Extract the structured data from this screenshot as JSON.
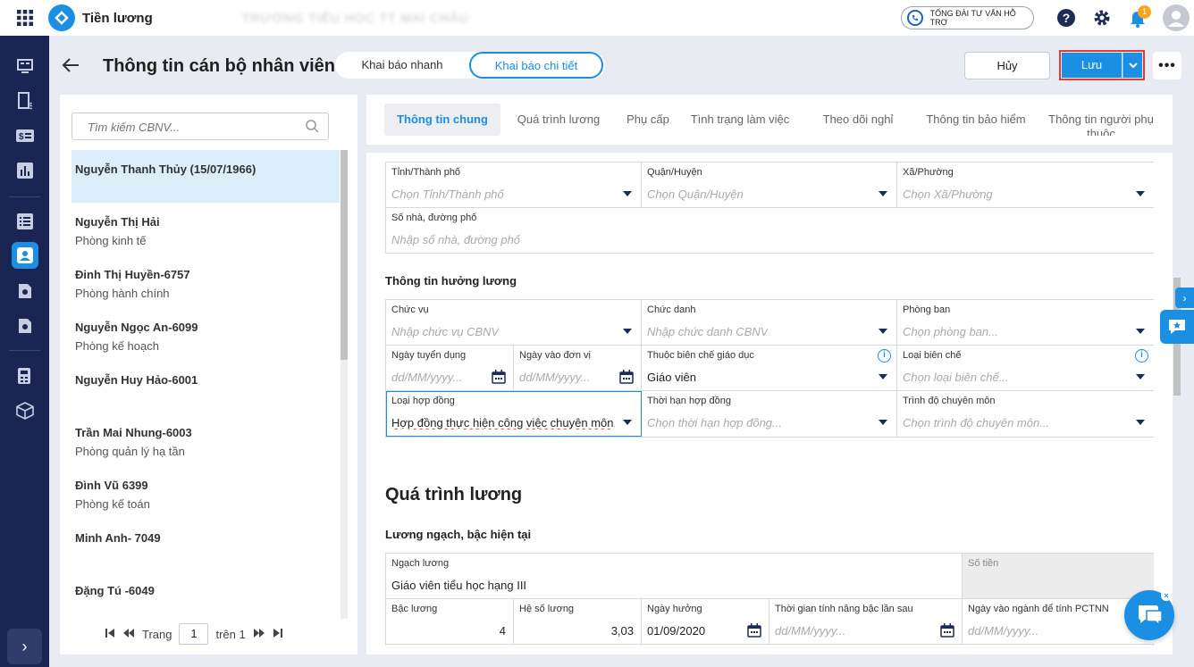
{
  "app": {
    "name": "Tiền lương",
    "school": "TRƯỜNG TIỂU HỌC TT MAI CHÂU",
    "hotline": "TỔNG ĐÀI TƯ VẤN HỖ TRỢ",
    "notif_count": "1"
  },
  "header": {
    "title": "Thông tin cán bộ nhân viên",
    "seg_quick": "Khai báo nhanh",
    "seg_detail": "Khai báo chi tiết",
    "cancel": "Hủy",
    "save": "Lưu"
  },
  "search": {
    "placeholder": "Tìm kiếm CBNV..."
  },
  "employees": [
    {
      "name": "Nguyễn Thanh Thủy (15/07/1966)",
      "dept": ""
    },
    {
      "name": "Nguyễn Thị Hải",
      "dept": "Phòng kinh tế"
    },
    {
      "name": "Đinh Thị Huyền-6757",
      "dept": "Phòng hành chính"
    },
    {
      "name": "Nguyễn Ngọc An-6099",
      "dept": "Phòng kế hoạch"
    },
    {
      "name": "Nguyễn Huy Hảo-6001",
      "dept": ""
    },
    {
      "name": "Trần Mai Nhung-6003",
      "dept": "Phòng quản lý hạ tần"
    },
    {
      "name": "Đình Vũ 6399",
      "dept": "Phòng kế toán"
    },
    {
      "name": "Minh Anh- 7049",
      "dept": ""
    },
    {
      "name": "Đặng Tú -6049",
      "dept": ""
    }
  ],
  "pager": {
    "label": "Trang",
    "page": "1",
    "of": "trên 1"
  },
  "tabs": [
    "Thông tin chung",
    "Quá trình lương",
    "Phụ cấp",
    "Tình trạng làm việc",
    "Theo dõi nghỉ",
    "Thông tin bảo hiểm",
    "Thông tin người phụ thuộc"
  ],
  "address": {
    "province": {
      "label": "Tỉnh/Thành phố",
      "placeholder": "Chọn Tỉnh/Thành phố"
    },
    "district": {
      "label": "Quận/Huyện",
      "placeholder": "Chọn Quận/Huyện"
    },
    "ward": {
      "label": "Xã/Phường",
      "placeholder": "Chọn Xã/Phường"
    },
    "street": {
      "label": "Số nhà, đường phố",
      "placeholder": "Nhập số nhà, đường phố"
    }
  },
  "salary_info": {
    "title": "Thông tin hưởng lương",
    "position": {
      "label": "Chức vụ",
      "placeholder": "Nhập chức vụ CBNV"
    },
    "job_title": {
      "label": "Chức danh",
      "placeholder": "Nhập chức danh CBNV"
    },
    "department": {
      "label": "Phòng ban",
      "placeholder": "Chọn phòng ban..."
    },
    "hire_date": {
      "label": "Ngày tuyển dụng",
      "placeholder": "dd/MM/yyyy..."
    },
    "join_date": {
      "label": "Ngày vào đơn vị",
      "placeholder": "dd/MM/yyyy..."
    },
    "staff_type": {
      "label": "Thuộc biên chế giáo dục",
      "value": "Giáo viên"
    },
    "staff_kind": {
      "label": "Loại biên chế",
      "placeholder": "Chọn loại biên chế..."
    },
    "contract_type": {
      "label": "Loại hợp đồng",
      "value": "Hợp đồng thực hiện công việc chuyên môn,"
    },
    "contract_term": {
      "label": "Thời hạn hợp đồng",
      "placeholder": "Chọn thời hạn hợp đồng..."
    },
    "qualification": {
      "label": "Trình độ chuyên môn",
      "placeholder": "Chọn trình độ chuyên môn..."
    }
  },
  "salary_process": {
    "title": "Quá trình lương",
    "subtitle": "Lương ngạch, bậc hiện tại",
    "grade": {
      "label": "Ngạch lương",
      "value": "Giáo viên tiểu học hạng III"
    },
    "amount": {
      "label": "Số tiền"
    },
    "level": {
      "label": "Bậc lương",
      "value": "4"
    },
    "coef": {
      "label": "Hệ số lương",
      "value": "3,03"
    },
    "effective": {
      "label": "Ngày hưởng",
      "value": "01/09/2020"
    },
    "next_raise": {
      "label": "Thời gian tính nâng bậc lần sau",
      "placeholder": "dd/MM/yyyy..."
    },
    "industry_date": {
      "label": "Ngày vào ngành để tính PCTNN",
      "placeholder": "dd/MM/yyyy..."
    }
  }
}
